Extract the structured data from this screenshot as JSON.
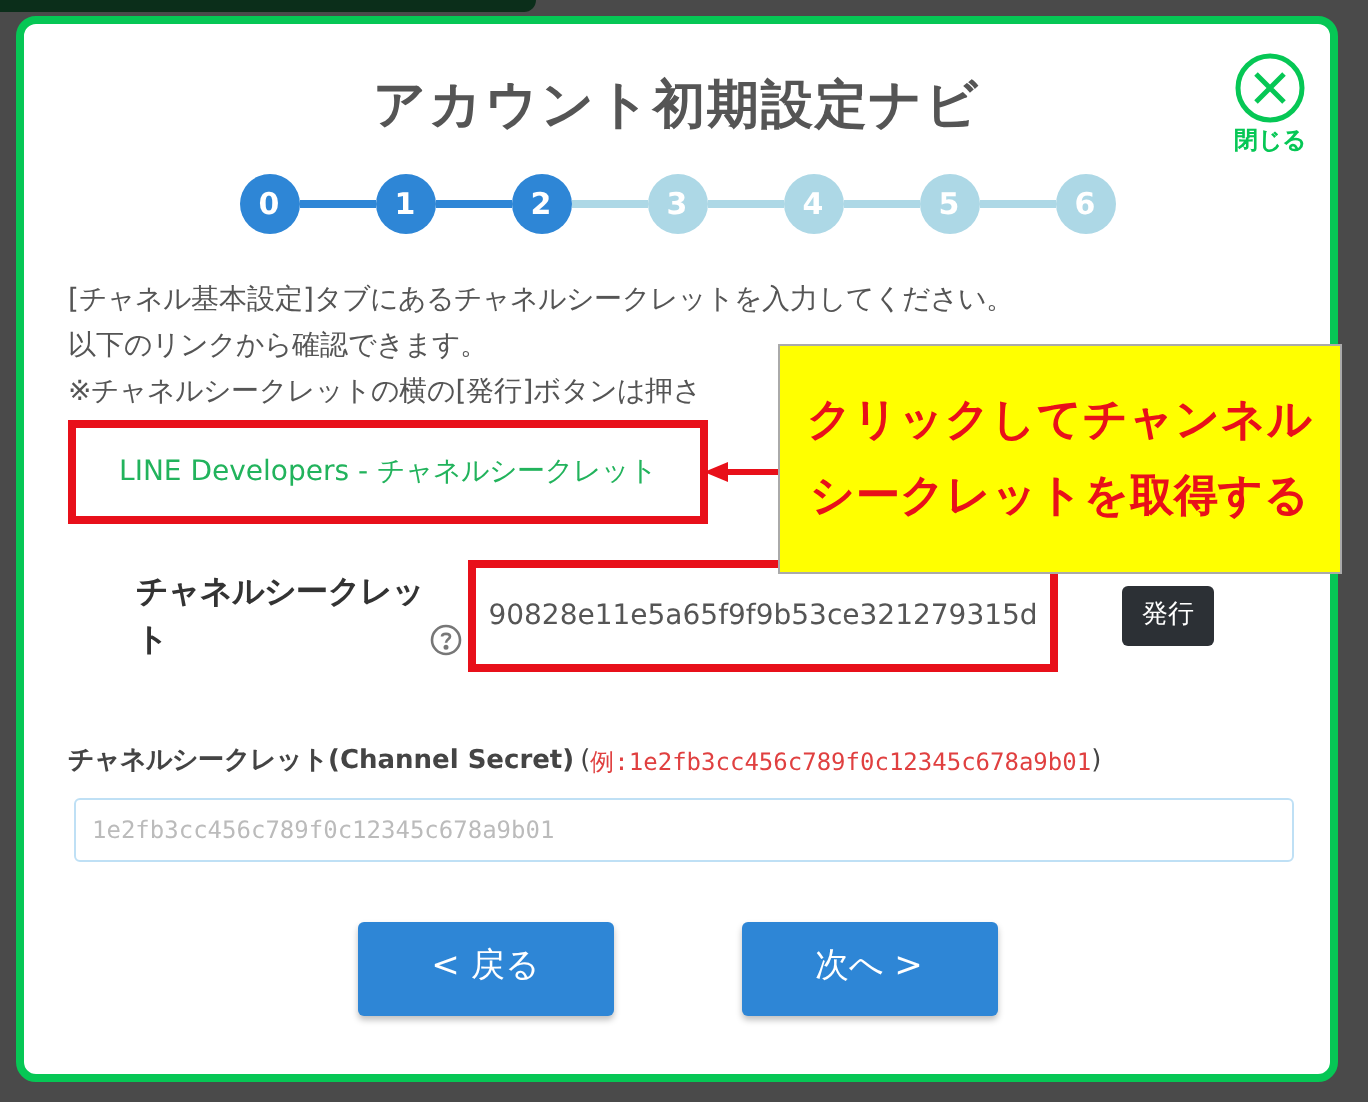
{
  "title": "アカウント初期設定ナビ",
  "close": {
    "label": "閉じる"
  },
  "steps": [
    {
      "label": "0",
      "done": true
    },
    {
      "label": "1",
      "done": true
    },
    {
      "label": "2",
      "done": true
    },
    {
      "label": "3",
      "done": false
    },
    {
      "label": "4",
      "done": false
    },
    {
      "label": "5",
      "done": false
    },
    {
      "label": "6",
      "done": false
    }
  ],
  "instructions": [
    "[チャネル基本設定]タブにあるチャネルシークレットを入力してください。",
    "以下のリンクから確認できます。",
    "※チャネルシークレットの横の[発行]ボタンは押さ"
  ],
  "link": {
    "label": "LINE Developers - チャネルシークレット",
    "highlighted": true
  },
  "callout": {
    "lines": [
      "クリックしてチャンネル",
      "シークレットを取得する"
    ]
  },
  "secret_row": {
    "label": "チャネルシークレット",
    "value": "90828e11e5a65f9f9b53ce321279315d",
    "highlighted": true,
    "issue_button": "発行"
  },
  "secret_field": {
    "label": "チャネルシークレット(Channel Secret)",
    "open_paren": "(",
    "example": "例:1e2fb3cc456c789f0c12345c678a9b01",
    "close_paren": ")",
    "placeholder": "1e2fb3cc456c789f0c12345c678a9b01"
  },
  "buttons": [
    {
      "label": "< 戻る"
    },
    {
      "label": "次へ >"
    }
  ]
}
